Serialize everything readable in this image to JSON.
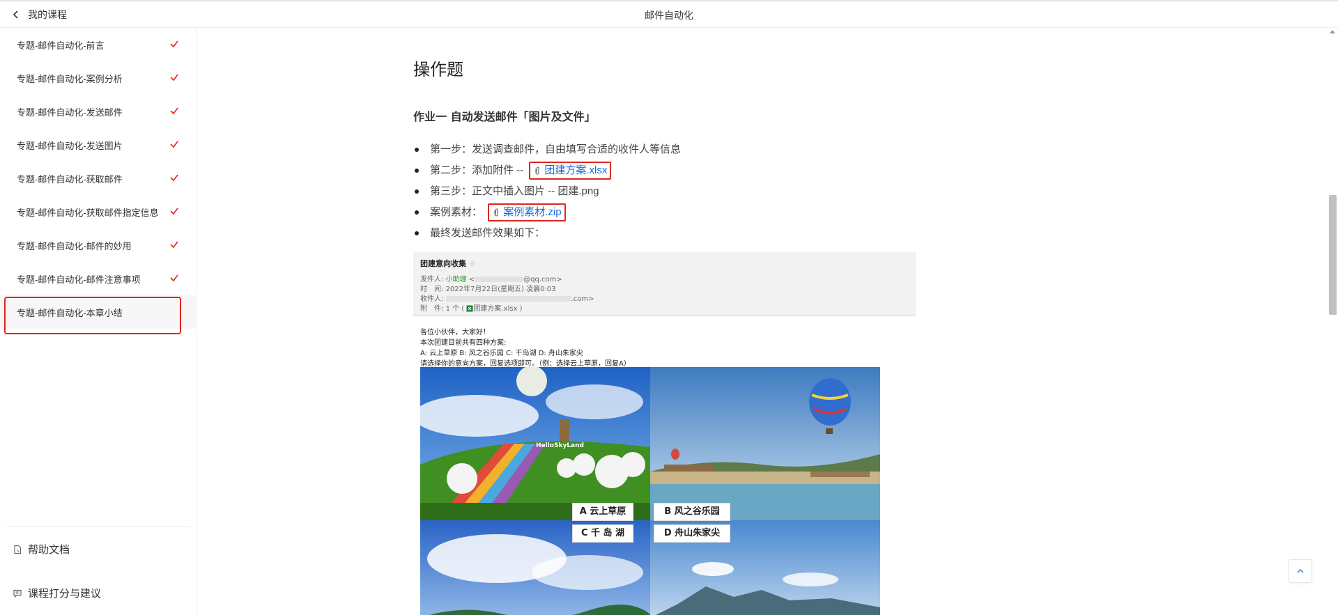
{
  "header": {
    "back_label": "我的课程",
    "title": "邮件自动化"
  },
  "sidebar": {
    "items": [
      {
        "label": "专题-邮件自动化-前言",
        "completed": true
      },
      {
        "label": "专题-邮件自动化-案例分析",
        "completed": true
      },
      {
        "label": "专题-邮件自动化-发送邮件",
        "completed": true
      },
      {
        "label": "专题-邮件自动化-发送图片",
        "completed": true
      },
      {
        "label": "专题-邮件自动化-获取邮件",
        "completed": true
      },
      {
        "label": "专题-邮件自动化-获取邮件指定信息",
        "completed": true
      },
      {
        "label": "专题-邮件自动化-邮件的妙用",
        "completed": true
      },
      {
        "label": "专题-邮件自动化-邮件注意事项",
        "completed": true
      },
      {
        "label": "专题-邮件自动化-本章小结",
        "completed": false,
        "active": true
      }
    ],
    "help_label": "帮助文档",
    "feedback_label": "课程打分与建议"
  },
  "content": {
    "heading": "操作题",
    "subheading": "作业一 自动发送邮件「图片及文件」",
    "steps": [
      {
        "text": "第一步：发送调查邮件，自由填写合适的收件人等信息"
      },
      {
        "text": "第二步：添加附件 --",
        "attachment": "团建方案.xlsx"
      },
      {
        "text": "第三步：正文中插入图片 -- 团建.png"
      },
      {
        "text": "案例素材：",
        "attachment": "案例素材.zip"
      },
      {
        "text": "最终发送邮件效果如下："
      }
    ]
  },
  "email_preview": {
    "subject": "团建意向收集",
    "star": "☆",
    "from_label": "发件人:",
    "from_name": "小助理",
    "from_addr_prefix": "<",
    "from_addr_suffix": "@qq.com>",
    "time_label": "时　间:",
    "time_value": "2022年7月22日(星期五) 凌晨0:03",
    "to_label": "收件人:",
    "to_suffix": ".com>",
    "attach_label": "附　件:",
    "attach_count": "1 个 (",
    "attach_name": "团建方案.xlsx",
    "attach_close": ")",
    "body_lines": [
      "各位小伙伴，大家好！",
      "本次团建目前共有四种方案:",
      "A: 云上草原 B: 风之谷乐园 C: 千岛湖 D: 舟山朱家尖",
      "请选择你的意向方案，回复选项即可。（例：选择云上草原，回复A）"
    ],
    "photo_signage": "HelloSkyLand",
    "tags": {
      "a": "A 云上草原",
      "b": "B 风之谷乐园",
      "c": "C 千 岛 湖",
      "d": "D 舟山朱家尖"
    }
  },
  "colors": {
    "accent_red": "#e1251b",
    "link_blue": "#1a6ad9"
  }
}
